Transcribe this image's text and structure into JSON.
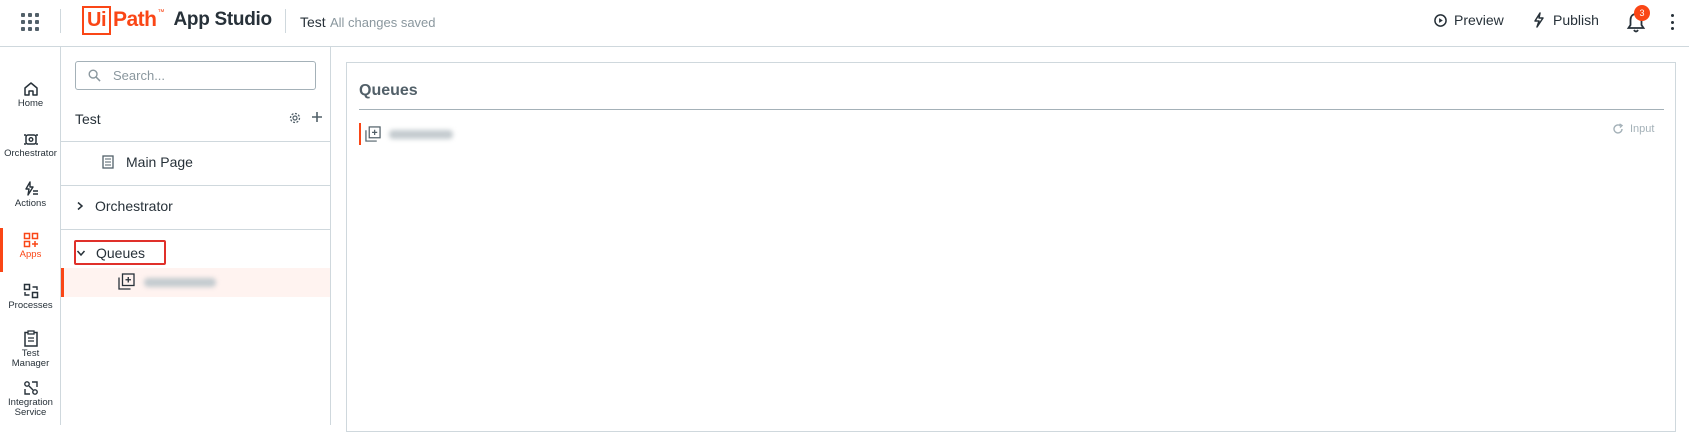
{
  "topbar": {
    "logo_box": "Ui",
    "logo_path": "Path",
    "logo_tm": "™",
    "app_name": "App Studio",
    "project_name": "Test",
    "save_status": "All changes saved",
    "preview_label": "Preview",
    "publish_label": "Publish",
    "notification_count": "3"
  },
  "nav": {
    "items": [
      {
        "label": "Home",
        "icon": "home-icon"
      },
      {
        "label": "Orchestrator",
        "icon": "robot-icon"
      },
      {
        "label": "Actions",
        "icon": "actions-icon"
      },
      {
        "label": "Apps",
        "icon": "apps-icon",
        "active": true
      },
      {
        "label": "Processes",
        "icon": "processes-icon"
      },
      {
        "label": "Test Manager",
        "icon": "clipboard-icon"
      },
      {
        "label": "Integration Service",
        "icon": "integration-icon"
      }
    ]
  },
  "tree": {
    "search_placeholder": "Search...",
    "project_title": "Test",
    "nodes": {
      "main_page": "Main Page",
      "orchestrator": "Orchestrator",
      "queues": "Queues"
    }
  },
  "canvas": {
    "title": "Queues",
    "input_label": "Input"
  },
  "colors": {
    "accent": "#fa4616",
    "highlight_box": "#e0302a",
    "text": "#273139",
    "muted": "#8a979e"
  }
}
